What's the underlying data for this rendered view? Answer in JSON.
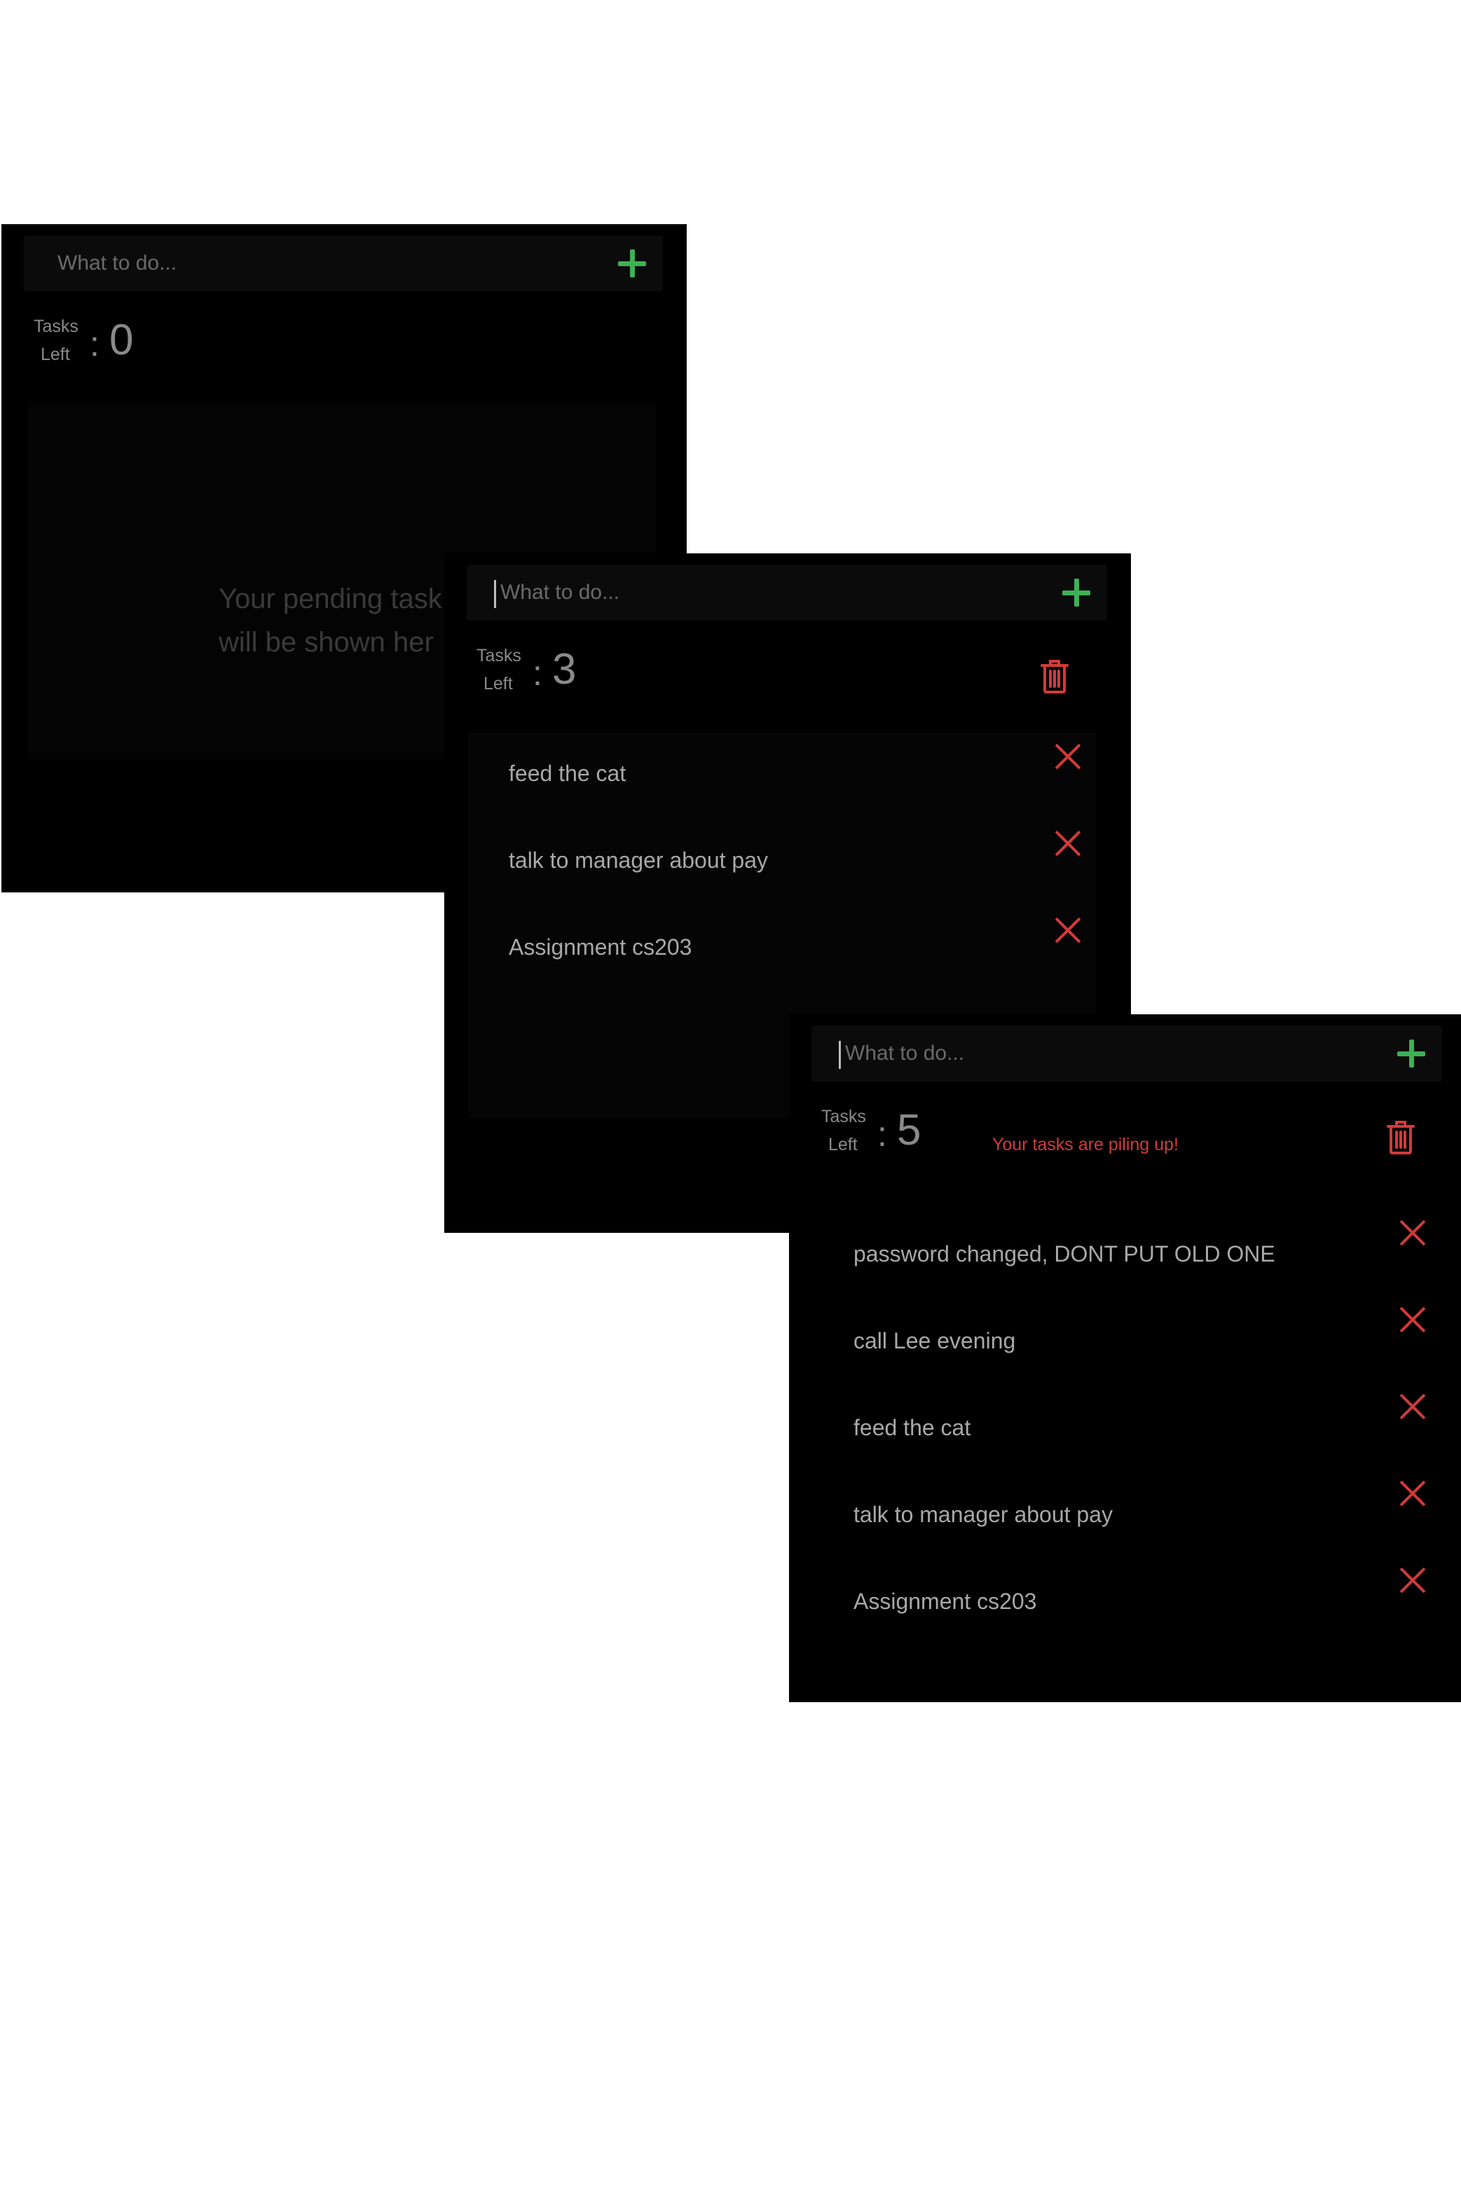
{
  "common": {
    "placeholder": "What to do...",
    "tasks_word": "Tasks",
    "left_word": "Left",
    "colon": ":",
    "add_icon": "plus-icon",
    "delete_icon": "close-icon",
    "trash_icon": "trash-icon",
    "colors": {
      "accent_add": "#3db155",
      "danger": "#d33a3a",
      "background": "#000000"
    }
  },
  "panel1": {
    "count": "0",
    "empty_line1": "Your pending task",
    "empty_line2": "will be shown her"
  },
  "panel2": {
    "count": "3",
    "tasks": [
      {
        "text": "feed the cat"
      },
      {
        "text": "talk to manager about pay"
      },
      {
        "text": "Assignment cs203"
      }
    ]
  },
  "panel3": {
    "count": "5",
    "warning": "Your tasks are piling up!",
    "tasks": [
      {
        "text": "password changed, DONT PUT OLD ONE"
      },
      {
        "text": "call Lee evening"
      },
      {
        "text": "feed the cat"
      },
      {
        "text": "talk to manager about pay"
      },
      {
        "text": "Assignment cs203"
      }
    ]
  }
}
